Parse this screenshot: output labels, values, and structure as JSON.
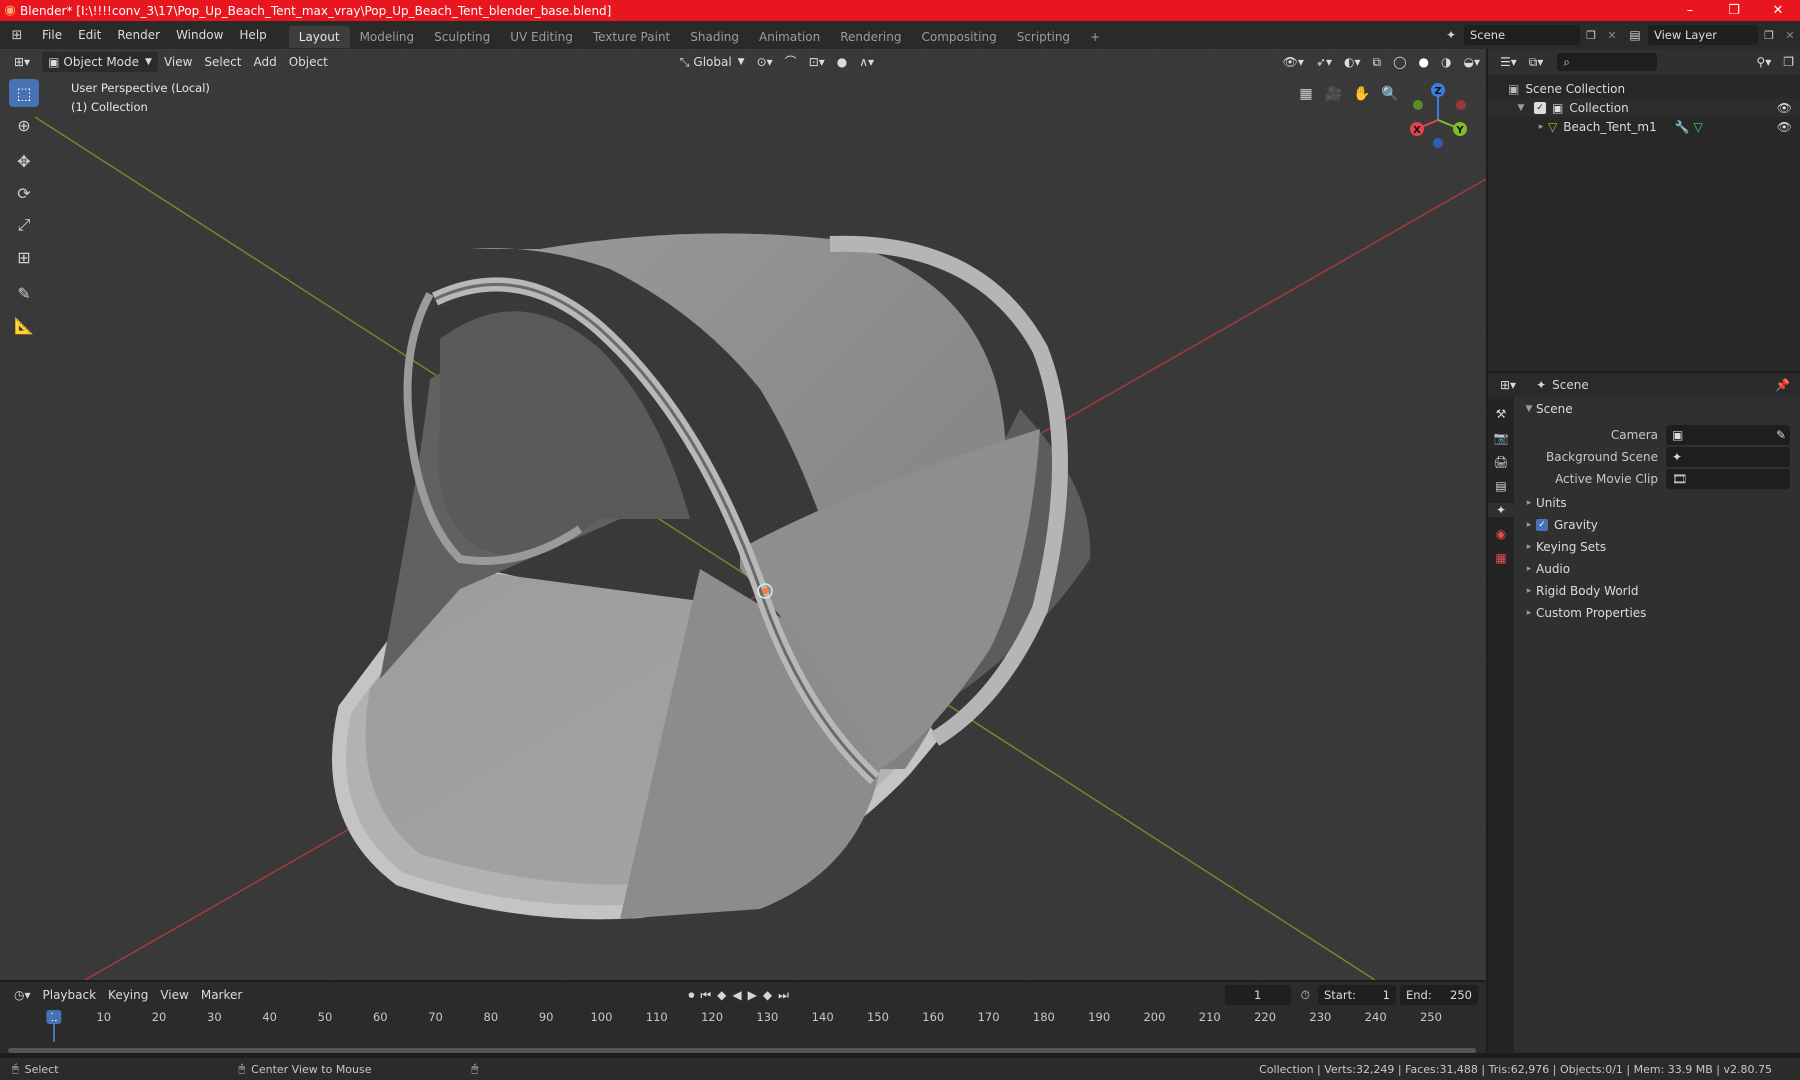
{
  "window": {
    "title": "Blender* [I:\\!!!!conv_3\\17\\Pop_Up_Beach_Tent_max_vray\\Pop_Up_Beach_Tent_blender_base.blend]",
    "min": "–",
    "max": "❐",
    "close": "✕"
  },
  "menu": [
    "File",
    "Edit",
    "Render",
    "Window",
    "Help"
  ],
  "workspaces": [
    "Layout",
    "Modeling",
    "Sculpting",
    "UV Editing",
    "Texture Paint",
    "Shading",
    "Animation",
    "Rendering",
    "Compositing",
    "Scripting"
  ],
  "add_tab": "+",
  "scene_name": "Scene",
  "view_layer": "View Layer",
  "viewport": {
    "mode": "Object Mode",
    "menus": [
      "View",
      "Select",
      "Add",
      "Object"
    ],
    "orientation": "Global",
    "info_line1": "User Perspective (Local)",
    "info_line2": "(1) Collection",
    "gizmo": {
      "x": "X",
      "y": "Y",
      "z": "Z"
    }
  },
  "outliner": {
    "root": "Scene Collection",
    "collection": "Collection",
    "object": "Beach_Tent_m1"
  },
  "properties": {
    "header": "Scene",
    "panel": "Scene",
    "camera_label": "Camera",
    "bgscene_label": "Background Scene",
    "movieclip_label": "Active Movie Clip",
    "sections": [
      "Units",
      "Gravity",
      "Keying Sets",
      "Audio",
      "Rigid Body World",
      "Custom Properties"
    ]
  },
  "timeline": {
    "menus": [
      "Playback",
      "Keying",
      "View",
      "Marker"
    ],
    "current_frame": "1",
    "start_label": "Start:",
    "start": "1",
    "end_label": "End:",
    "end": "250",
    "ticks": [
      "1",
      "10",
      "20",
      "30",
      "40",
      "50",
      "60",
      "70",
      "80",
      "90",
      "100",
      "110",
      "120",
      "130",
      "140",
      "150",
      "160",
      "170",
      "180",
      "190",
      "200",
      "210",
      "220",
      "230",
      "240",
      "250"
    ]
  },
  "status": {
    "select": "Select",
    "center": "Center View to Mouse",
    "stats": "Collection | Verts:32,249 | Faces:31,488 | Tris:62,976 | Objects:0/1 | Mem: 33.9 MB | v2.80.75"
  },
  "colors": {
    "titlebar": "#e8171f",
    "accent": "#4772b3",
    "x_axis": "#e0444a",
    "y_axis": "#7fbd2a",
    "z_axis": "#3b7ee1"
  }
}
